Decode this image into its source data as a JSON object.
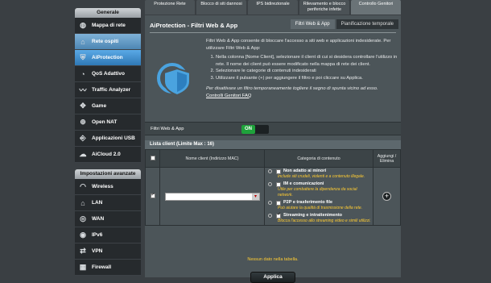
{
  "tabs": [
    "Protezione Rete",
    "Blocco di siti dannosi",
    "IPS bidirezionale",
    "Rilevamento e blocco periferiche infette",
    "Controllo Genitori"
  ],
  "sidebar": {
    "group1_title": "Generale",
    "items": [
      {
        "label": "Mappa di rete",
        "icon": "network-map-icon"
      },
      {
        "label": "Rete ospiti",
        "icon": "guest-network-icon"
      },
      {
        "label": "AiProtection",
        "icon": "aiprotection-icon"
      },
      {
        "label": "QoS Adattivo",
        "icon": "qos-icon"
      },
      {
        "label": "Traffic Analyzer",
        "icon": "traffic-analyzer-icon"
      },
      {
        "label": "Game",
        "icon": "game-icon"
      },
      {
        "label": "Open NAT",
        "icon": "open-nat-icon"
      },
      {
        "label": "Applicazioni USB",
        "icon": "usb-icon"
      },
      {
        "label": "AiCloud 2.0",
        "icon": "cloud-icon"
      }
    ],
    "group2_title": "Impostazioni avanzate",
    "adv_items": [
      {
        "label": "Wireless",
        "icon": "wireless-icon"
      },
      {
        "label": "LAN",
        "icon": "lan-icon"
      },
      {
        "label": "WAN",
        "icon": "wan-icon"
      },
      {
        "label": "IPv6",
        "icon": "ipv6-icon"
      },
      {
        "label": "VPN",
        "icon": "vpn-icon"
      },
      {
        "label": "Firewall",
        "icon": "firewall-icon"
      }
    ]
  },
  "main": {
    "title": "AiProtection - Filtri Web & App",
    "subtabs": [
      "Filtri Web & App",
      "Pianificazione temporale"
    ],
    "intro": "Filtri Web & App consente di bloccare l'accesso a siti web e applicazioni indesiderate. Per utilizzare Filtri Web & App:",
    "steps": [
      "Nella colonna [Nome Client], selezionare il client di cui si desidera controllare l'utilizzo in rete. Il nome dei client può essere modificato nella mappa di rete dei client.",
      "Selezionare le categorie di contenuti indesiderati",
      "Utilizzare il pulsante (+) per aggiungere il filtro e poi cliccare su Applica."
    ],
    "note": "Per disattivare un filtro temporaneamente togliere il segno di spunta vicino ad esso.",
    "faq_link": "Controlli Genitori FAQ",
    "toggle_label": "Filtri Web & App",
    "toggle_value": "ON",
    "list_title": "Lista client (Limite Max : 16)",
    "columns": [
      "Nome client (Indirizzo MAC)",
      "Categoria di contenuto",
      "Aggiungi / Elimina"
    ],
    "categories": [
      {
        "label": "Non adatto ai minori",
        "desc": "Include siti crudeli, violenti e a contenuto illegale."
      },
      {
        "label": "IM e comunicazioni",
        "desc": "Utile per combattere la dipendenza da social network."
      },
      {
        "label": "P2P e trasferimento file",
        "desc": "Può aiutare la qualità di trasmissione della rete."
      },
      {
        "label": "Streaming e intrattenimento",
        "desc": "Blocca l'accesso allo streaming video e simili utilizzi."
      }
    ],
    "no_data": "Nessun dato nella tabella.",
    "apply_label": "Applica"
  },
  "colors": {
    "accent": "#2f78b5",
    "toggle_on": "#1fa23b",
    "warning": "#ffcc33"
  }
}
